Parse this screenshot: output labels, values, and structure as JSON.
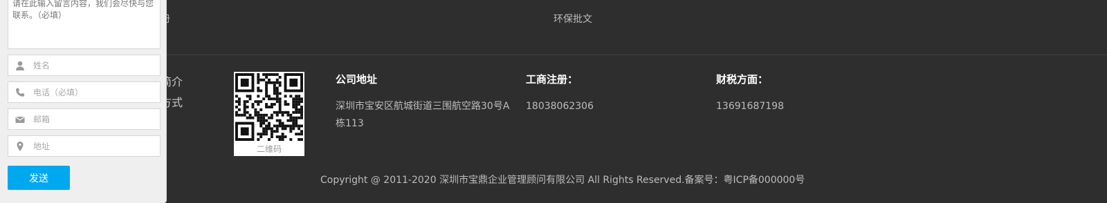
{
  "footer_top": {
    "left_link": "册",
    "mid_link": "环保批文"
  },
  "nav": {
    "items": [
      "简介",
      "方式"
    ]
  },
  "qr": {
    "label": "二维码"
  },
  "contact_info": {
    "address": {
      "title": "公司地址",
      "value": "深圳市宝安区航城街道三围航空路30号A栋113"
    },
    "registration": {
      "title": "工商注册：",
      "value": "18038062306"
    },
    "tax": {
      "title": "财税方面：",
      "value": "13691687198"
    }
  },
  "copyright": "Copyright @ 2011-2020 深圳市宝鼎企业管理顾问有限公司 All Rights Reserved.备案号：粤ICP备000000号",
  "contact_form": {
    "message_placeholder": "请在此输入留言内容，我们会尽快与您联系。（必填）",
    "name_placeholder": "姓名",
    "phone_placeholder": "电话（必填）",
    "email_placeholder": "邮箱",
    "address_placeholder": "地址",
    "send_label": "发送"
  },
  "colors": {
    "background": "#2e2e2e",
    "panel": "#efefef",
    "send_button": "#00a8f0"
  },
  "icons": [
    "user-icon",
    "phone-icon",
    "mail-icon",
    "location-pin-icon"
  ]
}
